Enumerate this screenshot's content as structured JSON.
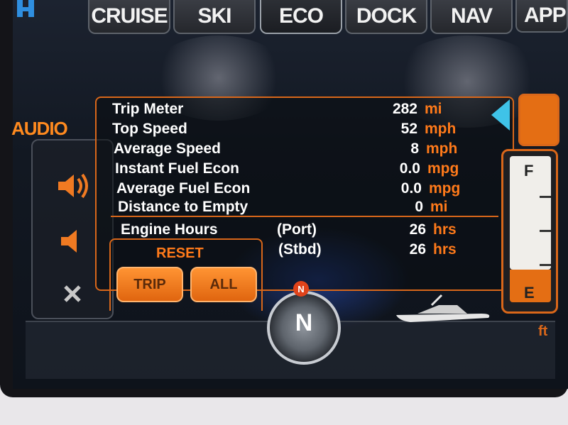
{
  "tabs": [
    {
      "label": "CRUISE"
    },
    {
      "label": "SKI"
    },
    {
      "label": "ECO"
    },
    {
      "label": "DOCK"
    },
    {
      "label": "NAV"
    },
    {
      "label": "APP"
    }
  ],
  "side": {
    "audio_label": "AUDIO"
  },
  "trip_data": [
    {
      "label": "Trip Meter",
      "value": "282",
      "unit": "mi"
    },
    {
      "label": "Top Speed",
      "value": "52",
      "unit": "mph"
    },
    {
      "label": "Average Speed",
      "value": "8",
      "unit": "mph"
    },
    {
      "label": "Instant Fuel Econ",
      "value": "0.0",
      "unit": "mpg"
    },
    {
      "label": "Average Fuel Econ",
      "value": "0.0",
      "unit": "mpg"
    },
    {
      "label": "Distance to Empty",
      "value": "0",
      "unit": "mi"
    }
  ],
  "engine_hours": {
    "label": "Engine Hours",
    "port": {
      "label": "(Port)",
      "value": "26",
      "unit": "hrs"
    },
    "stbd": {
      "label": "(Stbd)",
      "value": "26",
      "unit": "hrs"
    }
  },
  "reset": {
    "label": "RESET",
    "trip_button": "TRIP",
    "all_button": "ALL"
  },
  "fuel_gauge": {
    "full_label": "F",
    "empty_label": "E",
    "level": 0.2
  },
  "compass": {
    "heading": "N",
    "marker": "N"
  },
  "bottom": {
    "unit_label": "ft"
  },
  "colors": {
    "accent": "#ff7a1a",
    "pointer": "#3fc3e8"
  }
}
